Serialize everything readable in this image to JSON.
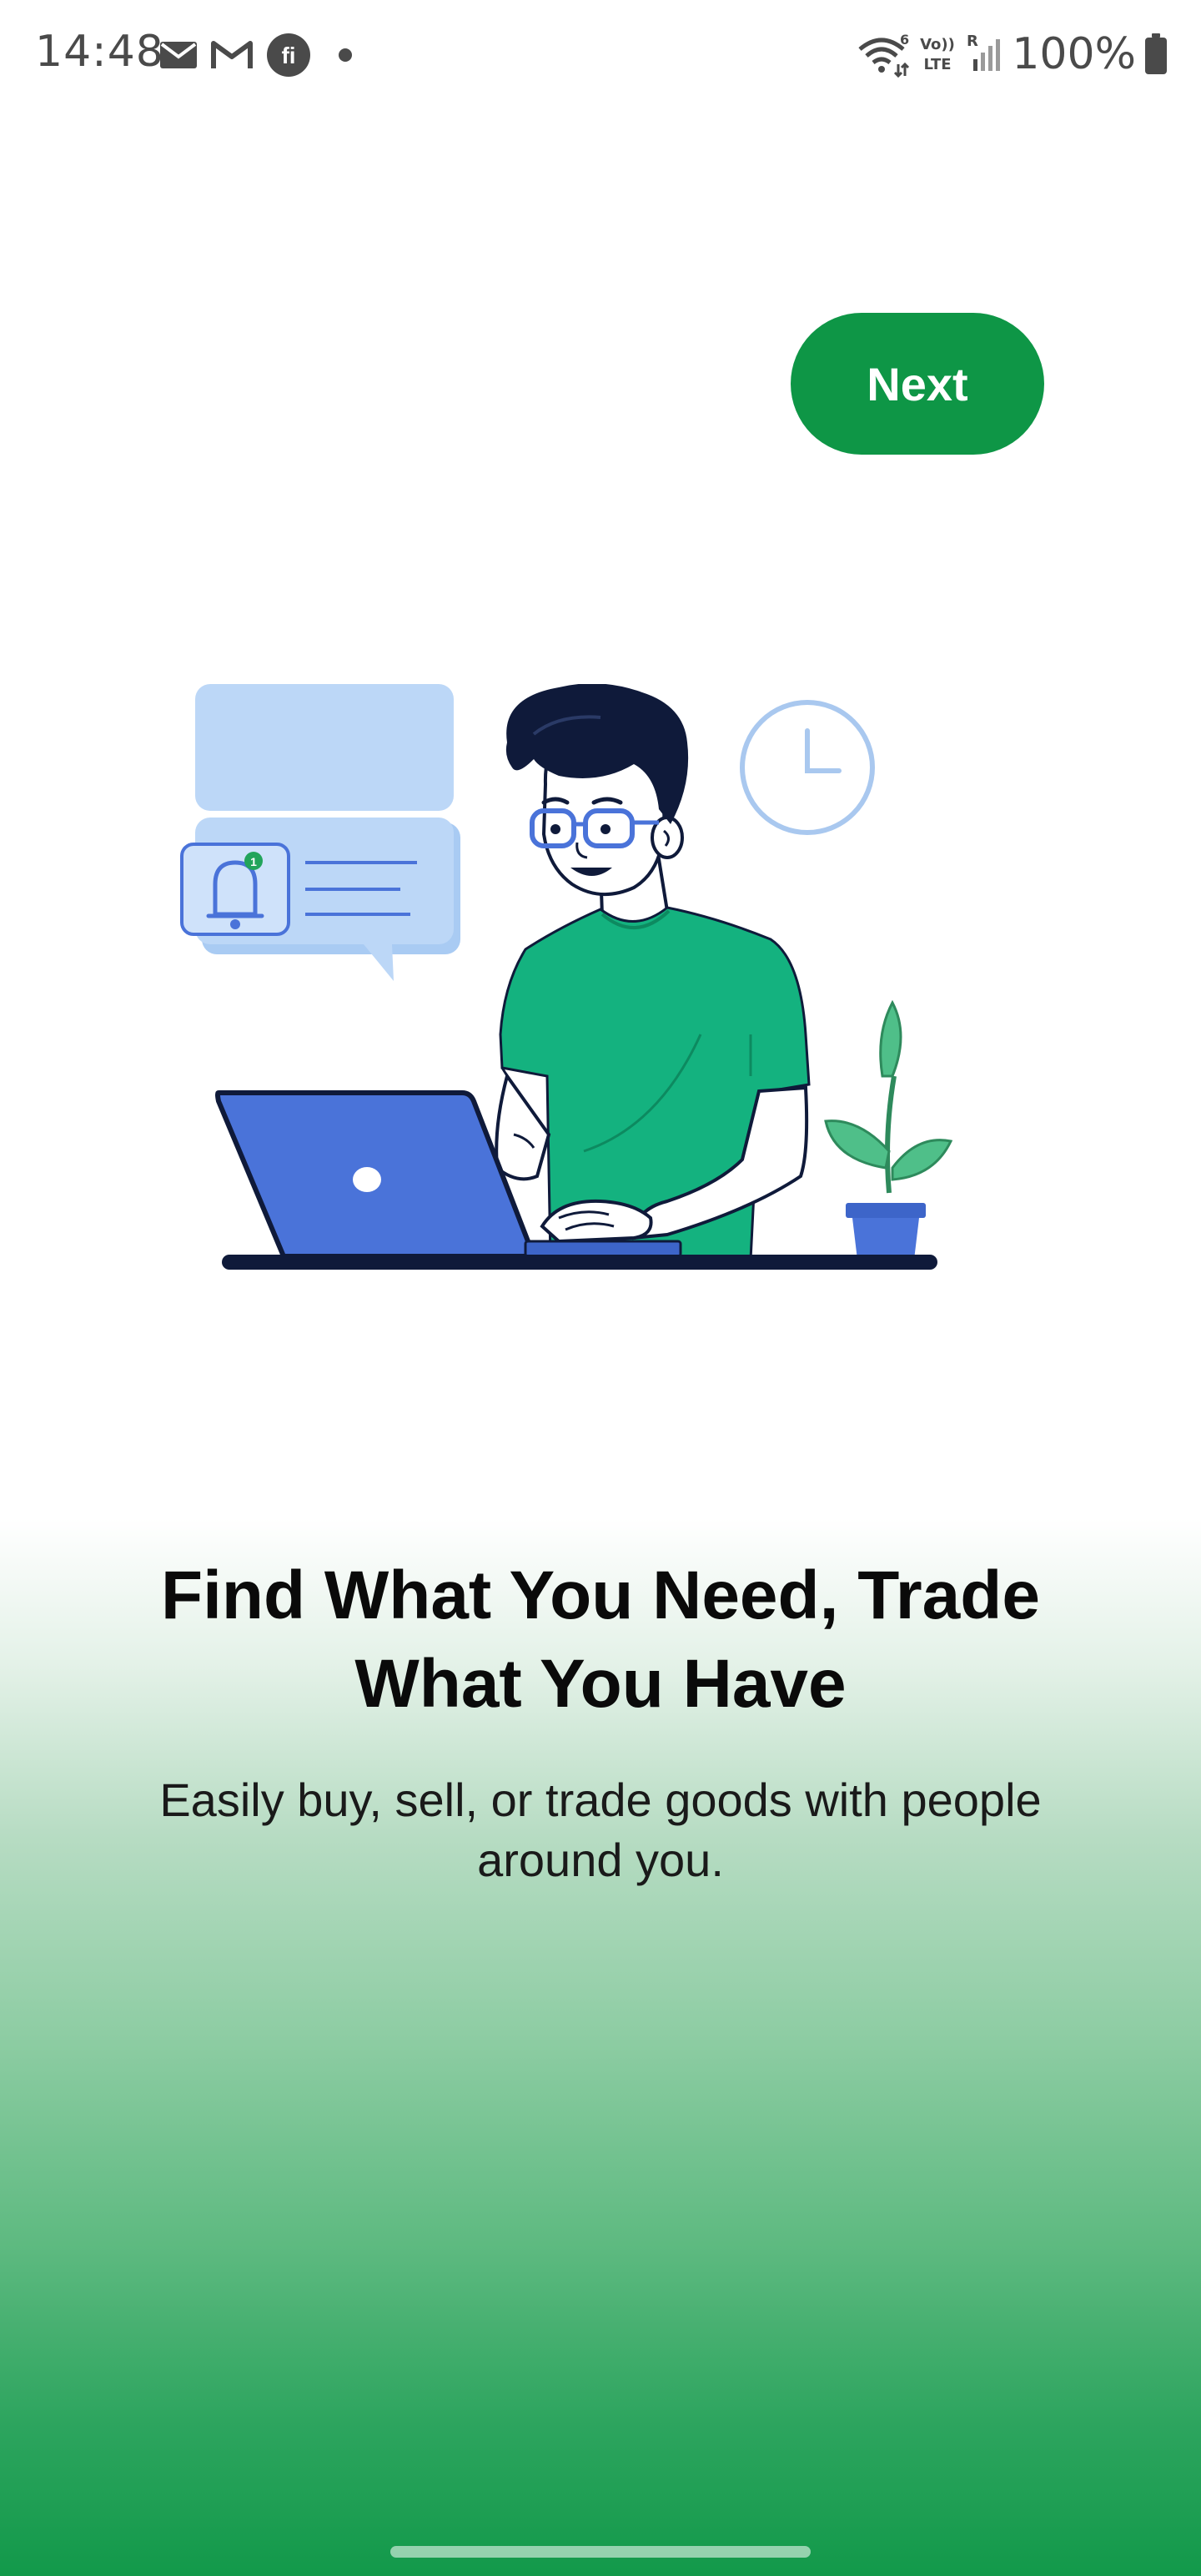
{
  "status_bar": {
    "time": "14:48",
    "left_icons": [
      "mail-icon",
      "gmail-icon",
      "fi-app-icon",
      "dot-icon"
    ],
    "right_icons": [
      "wifi-icon",
      "volte-icon",
      "signal-icon",
      "battery-icon"
    ],
    "volte_label_top": "Vo))",
    "volte_label_bottom": "LTE",
    "wifi_label": "6",
    "signal_label": "R",
    "battery": "100%"
  },
  "onboarding": {
    "next_label": "Next",
    "headline": "Find What You Need, Trade What You Have",
    "subtitle": "Easily buy, sell, or trade goods with people around you.",
    "notification_count": "1"
  },
  "colors": {
    "primary": "#0e9646",
    "shirt": "#14b27f",
    "laptop": "#4a73d9",
    "bubble": "#bcd7f7"
  }
}
